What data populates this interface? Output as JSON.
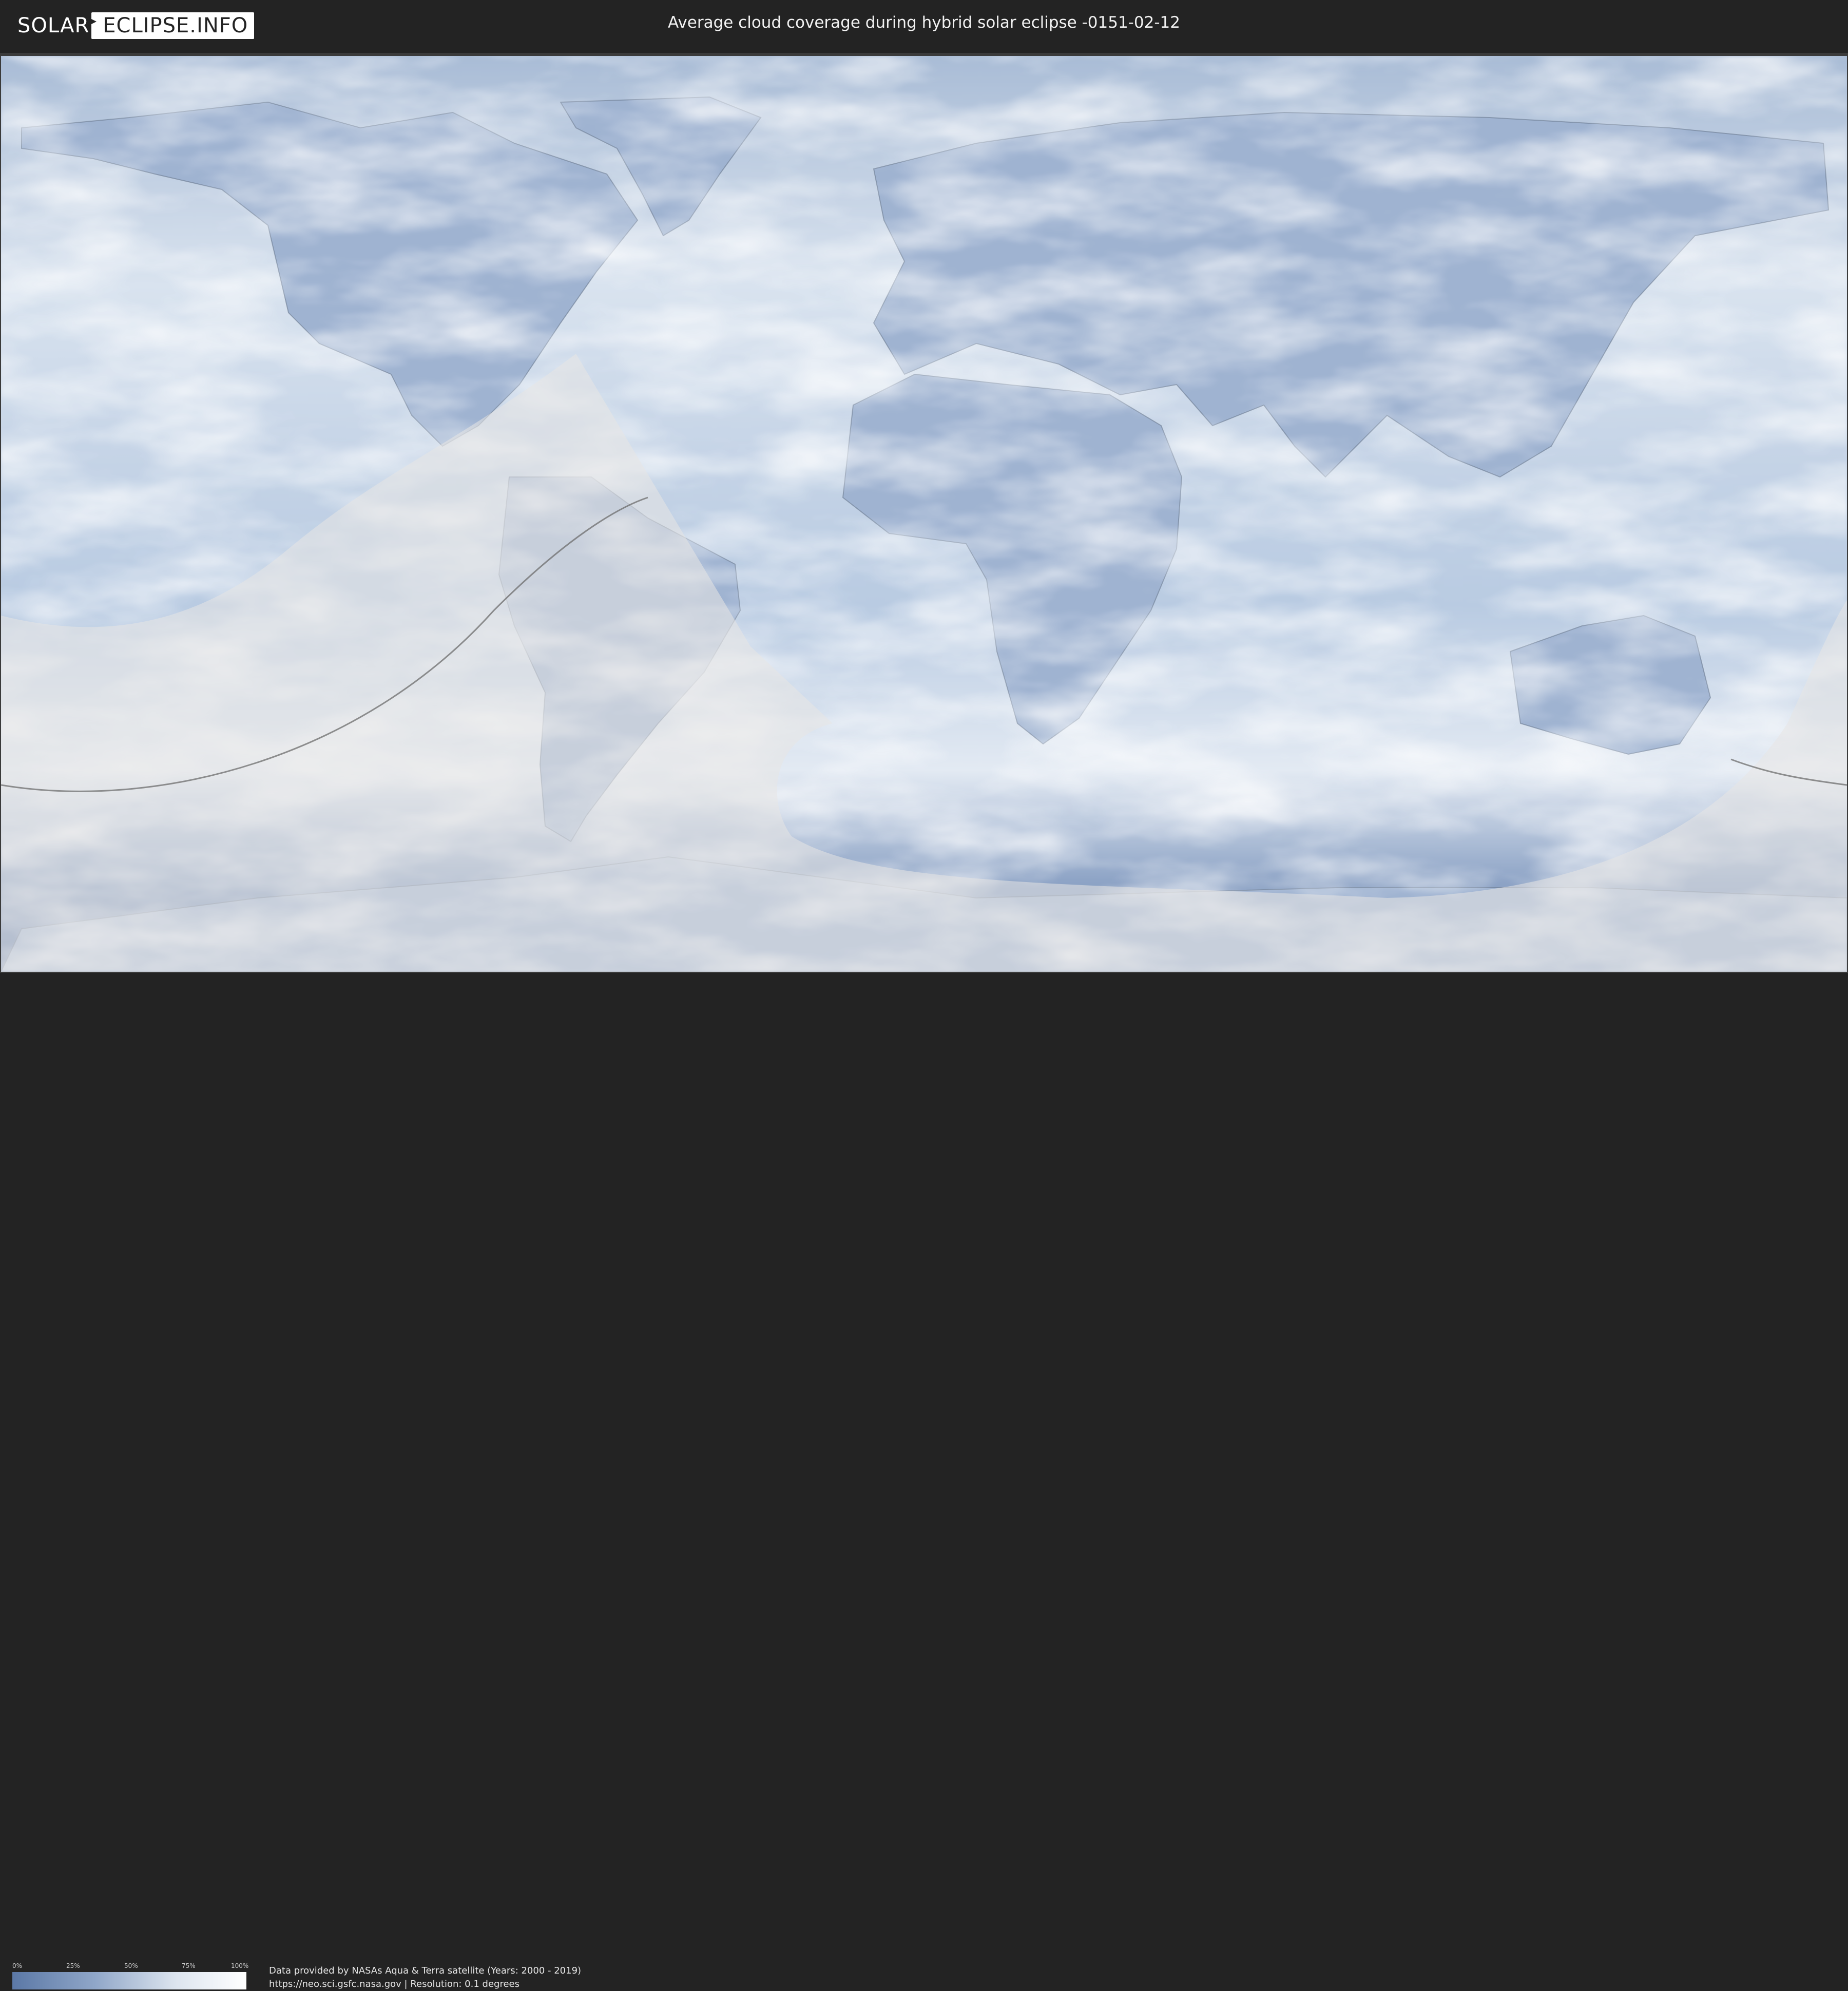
{
  "header": {
    "logo_left": "SOLAR",
    "logo_right": "ECLIPSE.INFO",
    "title": "Average cloud coverage during hybrid solar eclipse -0151-02-12"
  },
  "legend": {
    "ticks": [
      "0%",
      "25%",
      "50%",
      "75%",
      "100%"
    ],
    "gradient_colors": [
      "#5b78a6",
      "#8fa6c8",
      "#dde5ef",
      "#ffffff"
    ]
  },
  "credits": {
    "line1": "Data provided by NASAs Aqua & Terra satellite (Years: 2000 - 2019)",
    "line2": "https://neo.sci.gsfc.nasa.gov | Resolution: 0.1 degrees"
  },
  "map": {
    "projection": "equirectangular",
    "colors": {
      "clear_sky": "#6d88b3",
      "cloudy": "#f4f7fb",
      "ocean_base": "#c7d5e7",
      "eclipse_shade": "#e5e5e5",
      "border_line": "#6b7a8f"
    }
  }
}
